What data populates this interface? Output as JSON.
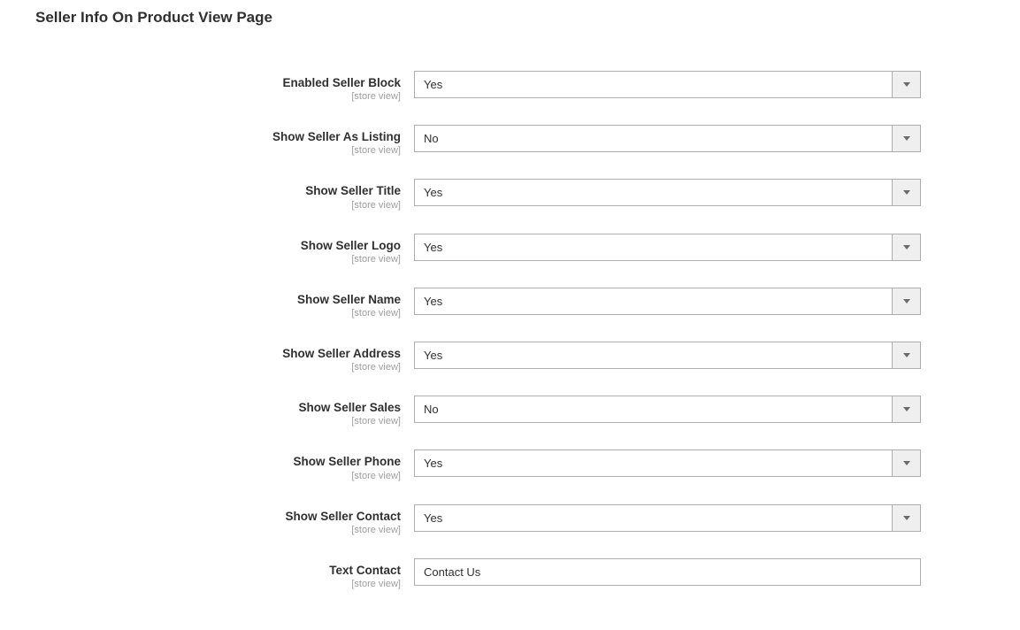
{
  "section": {
    "title": "Seller Info On Product View Page"
  },
  "fields": [
    {
      "label": "Enabled Seller Block",
      "scope": "[store view]",
      "type": "select",
      "value": "Yes",
      "name": "enabled-seller-block"
    },
    {
      "label": "Show Seller As Listing",
      "scope": "[store view]",
      "type": "select",
      "value": "No",
      "name": "show-seller-as-listing"
    },
    {
      "label": "Show Seller Title",
      "scope": "[store view]",
      "type": "select",
      "value": "Yes",
      "name": "show-seller-title"
    },
    {
      "label": "Show Seller Logo",
      "scope": "[store view]",
      "type": "select",
      "value": "Yes",
      "name": "show-seller-logo"
    },
    {
      "label": "Show Seller Name",
      "scope": "[store view]",
      "type": "select",
      "value": "Yes",
      "name": "show-seller-name"
    },
    {
      "label": "Show Seller Address",
      "scope": "[store view]",
      "type": "select",
      "value": "Yes",
      "name": "show-seller-address"
    },
    {
      "label": "Show Seller Sales",
      "scope": "[store view]",
      "type": "select",
      "value": "No",
      "name": "show-seller-sales"
    },
    {
      "label": "Show Seller Phone",
      "scope": "[store view]",
      "type": "select",
      "value": "Yes",
      "name": "show-seller-phone"
    },
    {
      "label": "Show Seller Contact",
      "scope": "[store view]",
      "type": "select",
      "value": "Yes",
      "name": "show-seller-contact"
    },
    {
      "label": "Text Contact",
      "scope": "[store view]",
      "type": "text",
      "value": "Contact Us",
      "name": "text-contact"
    }
  ]
}
